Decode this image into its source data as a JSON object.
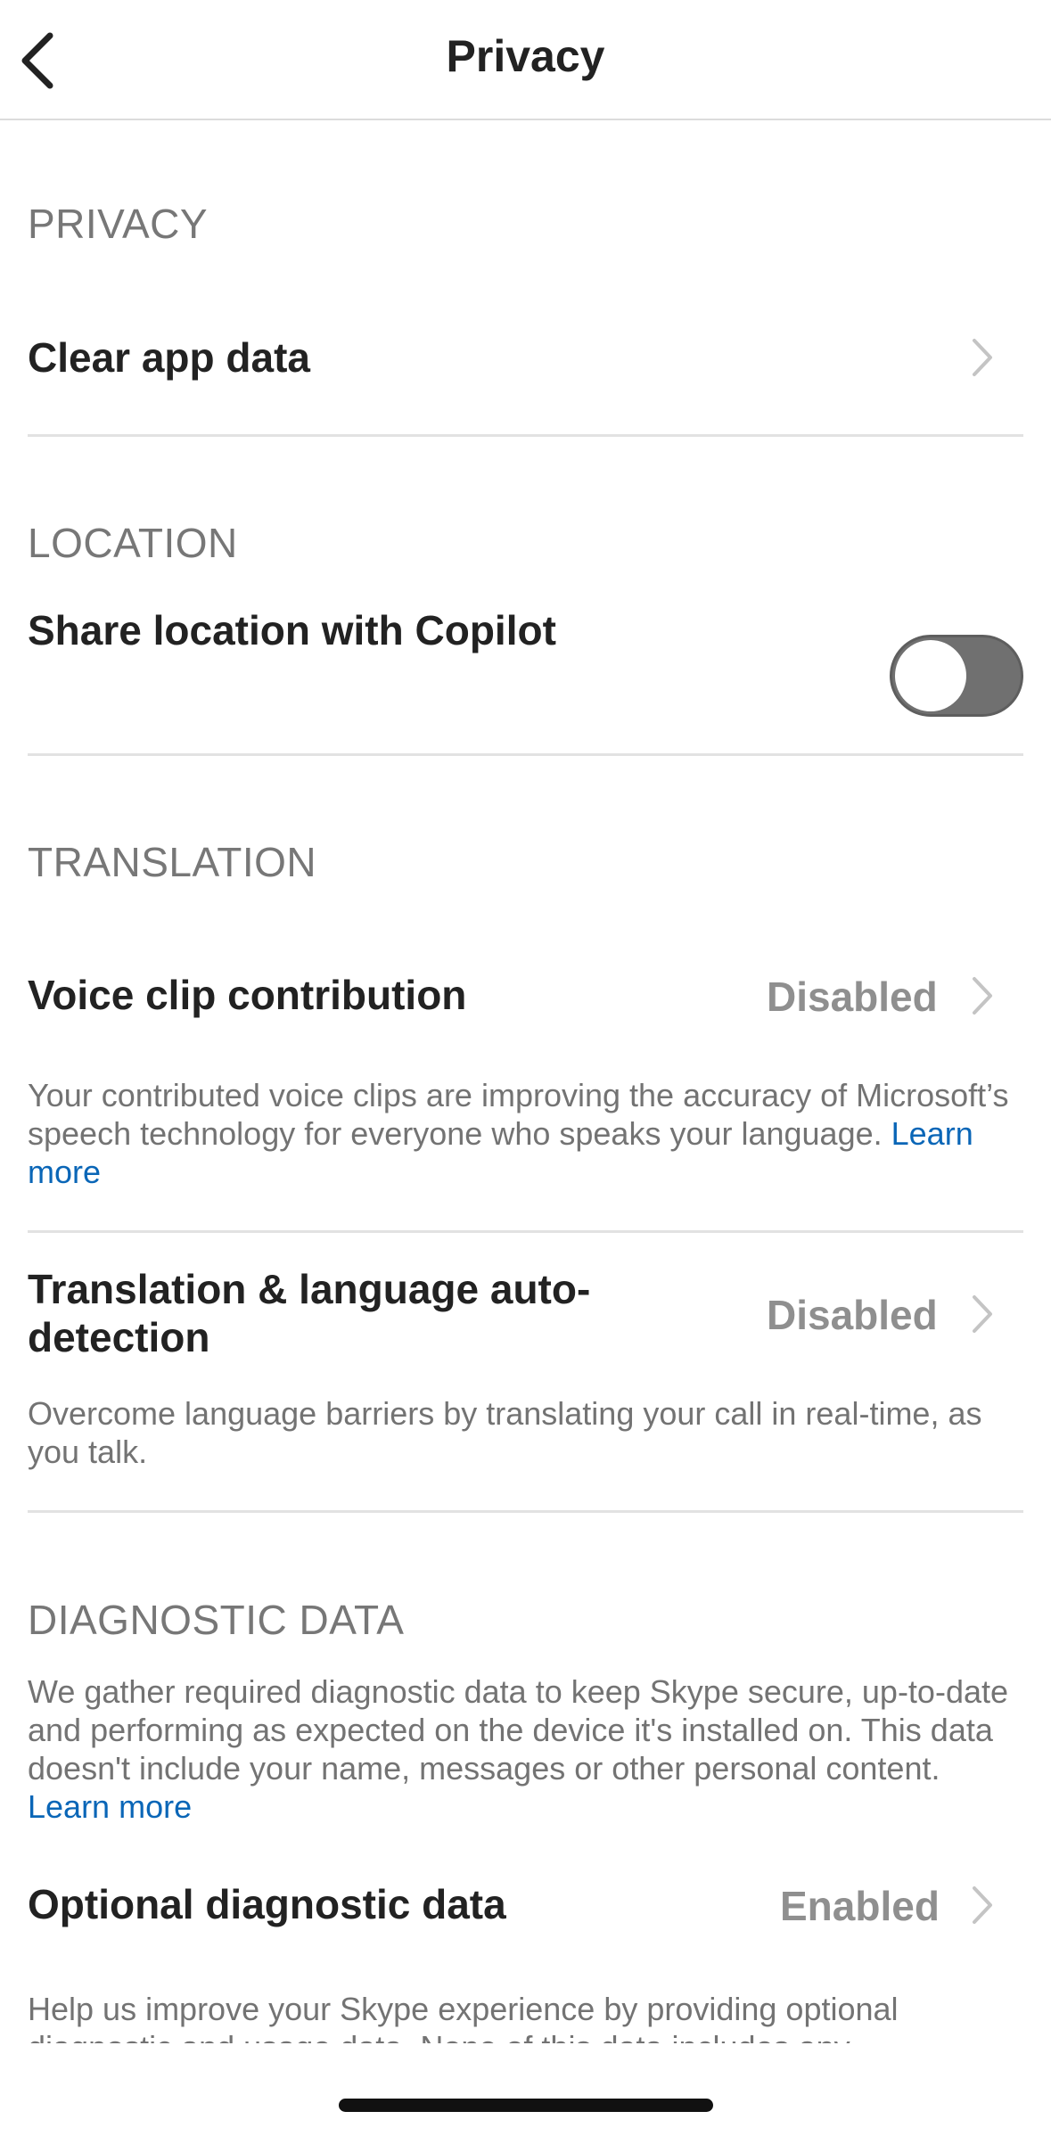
{
  "header": {
    "title": "Privacy"
  },
  "sections": {
    "privacy": {
      "header": "PRIVACY",
      "clear_app_data": "Clear app data"
    },
    "location": {
      "header": "LOCATION",
      "share_location": "Share location with Copilot",
      "share_location_enabled": false
    },
    "translation": {
      "header": "TRANSLATION",
      "voice_clip": {
        "label": "Voice clip contribution",
        "value": "Disabled",
        "desc": "Your contributed voice clips are improving the accuracy of Microsoft’s speech technology for everyone who speaks your language.",
        "link": "Learn more"
      },
      "translation_auto": {
        "label_line1": "Translation & language auto-",
        "label_line2": "detection",
        "value": "Disabled",
        "desc": "Overcome language barriers by translating your call in real-time, as you talk."
      }
    },
    "diagnostic": {
      "header": "DIAGNOSTIC DATA",
      "desc": "We gather required diagnostic data to keep Skype secure, up-to-date and performing as expected on the device it's installed on. This data doesn't include your name, messages or other personal content.",
      "link": "Learn more",
      "optional": {
        "label": "Optional diagnostic data",
        "value": "Enabled",
        "desc": "Help us improve your Skype experience by providing optional diagnostic and usage data. None of this data includes any"
      }
    }
  },
  "colors": {
    "link": "#0a66b7",
    "toggle_off": "#707070",
    "section_header": "#777777"
  }
}
